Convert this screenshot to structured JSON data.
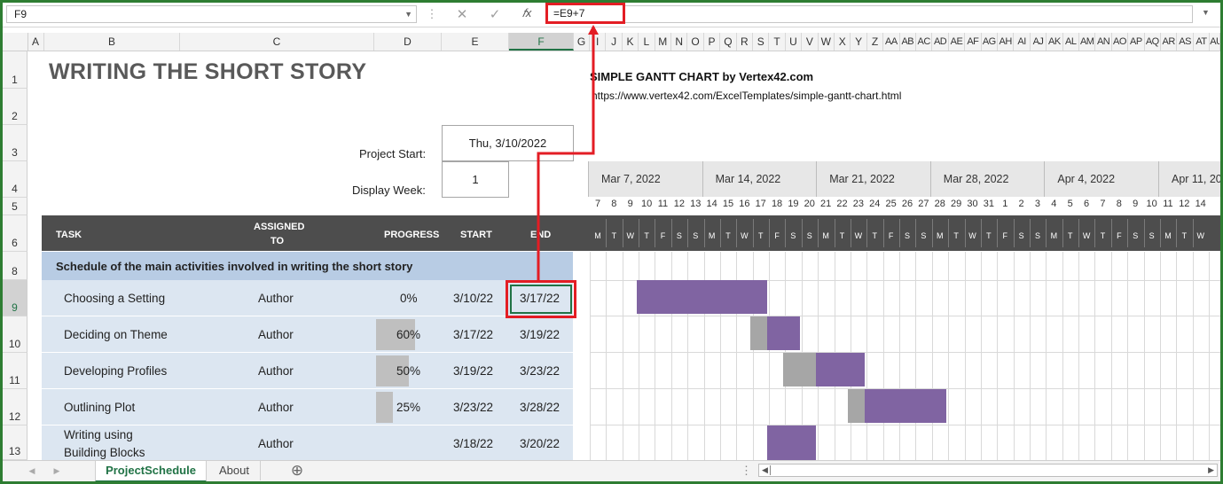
{
  "formula_bar": {
    "name_box": "F9",
    "formula": "=E9+7",
    "icons": [
      "cancel-icon",
      "enter-icon",
      "function-icon"
    ],
    "cancel_glyph": "✕",
    "enter_glyph": "✓",
    "fx_glyph": "𝑓x",
    "more_glyph": "⋮"
  },
  "columns": [
    "A",
    "B",
    "C",
    "D",
    "E",
    "F",
    "G",
    "I",
    "J",
    "K",
    "L",
    "M",
    "N",
    "O",
    "P",
    "Q",
    "R",
    "S",
    "T",
    "U",
    "V",
    "W",
    "X",
    "Y",
    "Z",
    "AA",
    "AB",
    "AC",
    "AD",
    "AE",
    "AF",
    "AG",
    "AH",
    "AI",
    "AJ",
    "AK",
    "AL",
    "AM",
    "AN",
    "AO",
    "AP",
    "AQ",
    "AR",
    "AS",
    "AT",
    "AU"
  ],
  "selected_column": "F",
  "rows": [
    "1",
    "2",
    "3",
    "4",
    "5",
    "6",
    "8",
    "9",
    "10",
    "11",
    "12",
    "13"
  ],
  "selected_row": "9",
  "sheet": {
    "title": "WRITING THE SHORT STORY",
    "project_start_label": "Project Start:",
    "project_start_value": "Thu, 3/10/2022",
    "display_week_label": "Display Week:",
    "display_week_value": "1",
    "gantt_title": "SIMPLE GANTT CHART by Vertex42.com",
    "gantt_url": "https://www.vertex42.com/ExcelTemplates/simple-gantt-chart.html",
    "headers": {
      "task": "TASK",
      "assigned_1": "ASSIGNED",
      "assigned_2": "TO",
      "progress": "PROGRESS",
      "start": "START",
      "end": "END"
    },
    "weeks": [
      "Mar 7, 2022",
      "Mar 14, 2022",
      "Mar 21, 2022",
      "Mar 28, 2022",
      "Apr 4, 2022",
      "Apr 11, 20"
    ],
    "day_numbers": [
      "7",
      "8",
      "9",
      "10",
      "11",
      "12",
      "13",
      "14",
      "15",
      "16",
      "17",
      "18",
      "19",
      "20",
      "21",
      "22",
      "23",
      "24",
      "25",
      "26",
      "27",
      "28",
      "29",
      "30",
      "31",
      "1",
      "2",
      "3",
      "4",
      "5",
      "6",
      "7",
      "8",
      "9",
      "10",
      "11",
      "12",
      "14"
    ],
    "day_letters": [
      "M",
      "T",
      "W",
      "T",
      "F",
      "S",
      "S",
      "M",
      "T",
      "W",
      "T",
      "F",
      "S",
      "S",
      "M",
      "T",
      "W",
      "T",
      "F",
      "S",
      "S",
      "M",
      "T",
      "W",
      "T",
      "F",
      "S",
      "S",
      "M",
      "T",
      "W",
      "T",
      "F",
      "S",
      "S",
      "M",
      "T",
      "W"
    ],
    "section_title": "Schedule of the main activities involved in writing the short story",
    "tasks": [
      {
        "name": "Choosing a Setting",
        "assigned": "Author",
        "progress": "0%",
        "progress_value": 0,
        "start": "3/10/22",
        "end": "3/17/22"
      },
      {
        "name": "Deciding on Theme",
        "assigned": "Author",
        "progress": "60%",
        "progress_value": 60,
        "start": "3/17/22",
        "end": "3/19/22"
      },
      {
        "name": "Developing Profiles",
        "assigned": "Author",
        "progress": "50%",
        "progress_value": 50,
        "start": "3/19/22",
        "end": "3/23/22"
      },
      {
        "name": "Outlining Plot",
        "assigned": "Author",
        "progress": "25%",
        "progress_value": 25,
        "start": "3/23/22",
        "end": "3/28/22"
      },
      {
        "name_1": "Writing using",
        "name_2": "Building Blocks",
        "assigned": "Author",
        "progress": "",
        "start": "3/18/22",
        "end": "3/20/22"
      }
    ]
  },
  "tabs": {
    "active": "ProjectSchedule",
    "other": "About",
    "add_glyph": "⊕",
    "prev_glyph": "◀",
    "next_glyph": "▶"
  },
  "colors": {
    "gantt_bar": "#8064a2",
    "gantt_done": "#a6a6a6",
    "task_band": "#dce6f1",
    "section_band": "#b8cce4",
    "header_band": "#4d4d4d",
    "highlight": "#e31d24",
    "excel_green": "#217346"
  }
}
